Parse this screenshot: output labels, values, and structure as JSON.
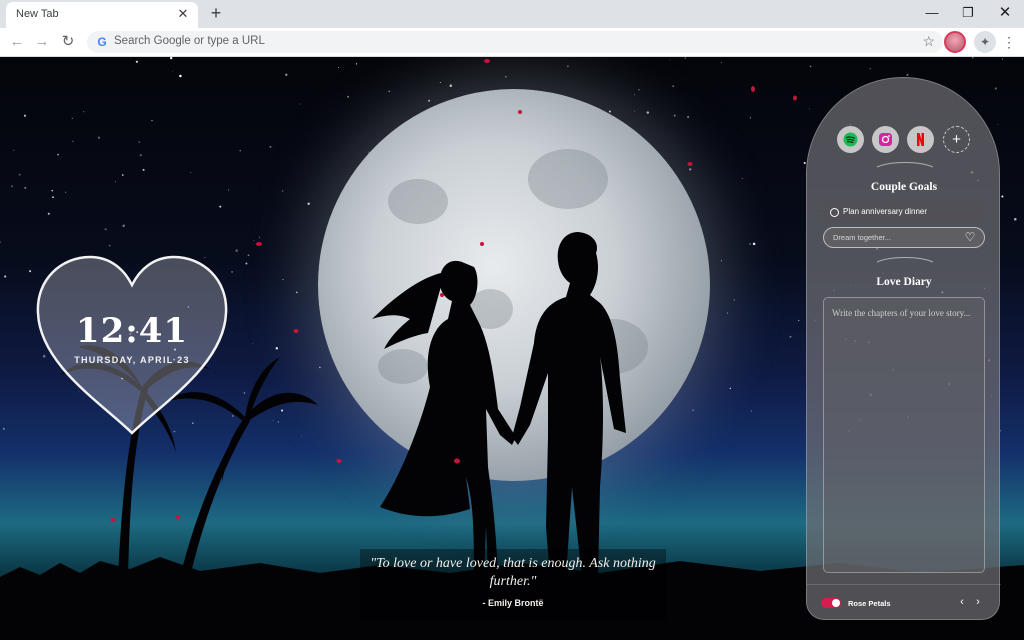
{
  "browser": {
    "tab_title": "New Tab",
    "tab_close": "✕",
    "new_tab": "+",
    "window_minimize": "—",
    "window_restore": "❐",
    "window_close": "✕",
    "omnibox_placeholder": "Search Google or type a URL",
    "google_logo": "G",
    "icons": [
      "back-icon",
      "forward-icon",
      "reload-icon",
      "star-icon",
      "extensions-icon",
      "menu-icon"
    ]
  },
  "clock": {
    "time": "12:41",
    "date": "THURSDAY, APRIL 23"
  },
  "quote": {
    "text": "\"To love or have loved, that is enough. Ask nothing further.\"",
    "author": "- Emily Brontë"
  },
  "panel": {
    "shortcuts": [
      {
        "name": "spotify",
        "color": "#1db954"
      },
      {
        "name": "instagram",
        "color": "#d6249f"
      },
      {
        "name": "netflix",
        "color": "#e50914"
      }
    ],
    "add_shortcut": "+",
    "goals_title": "Couple Goals",
    "goal_item": "Plan anniversary dinner",
    "dream_placeholder": "Dream together...",
    "diary_title": "Love Diary",
    "diary_placeholder": "Write the chapters of your love story...",
    "toggle_label": "Rose Petals",
    "toggle_on": true,
    "prev": "‹",
    "next": "›"
  },
  "colors": {
    "accent": "#d51d4f",
    "petal": "#c4143a"
  }
}
